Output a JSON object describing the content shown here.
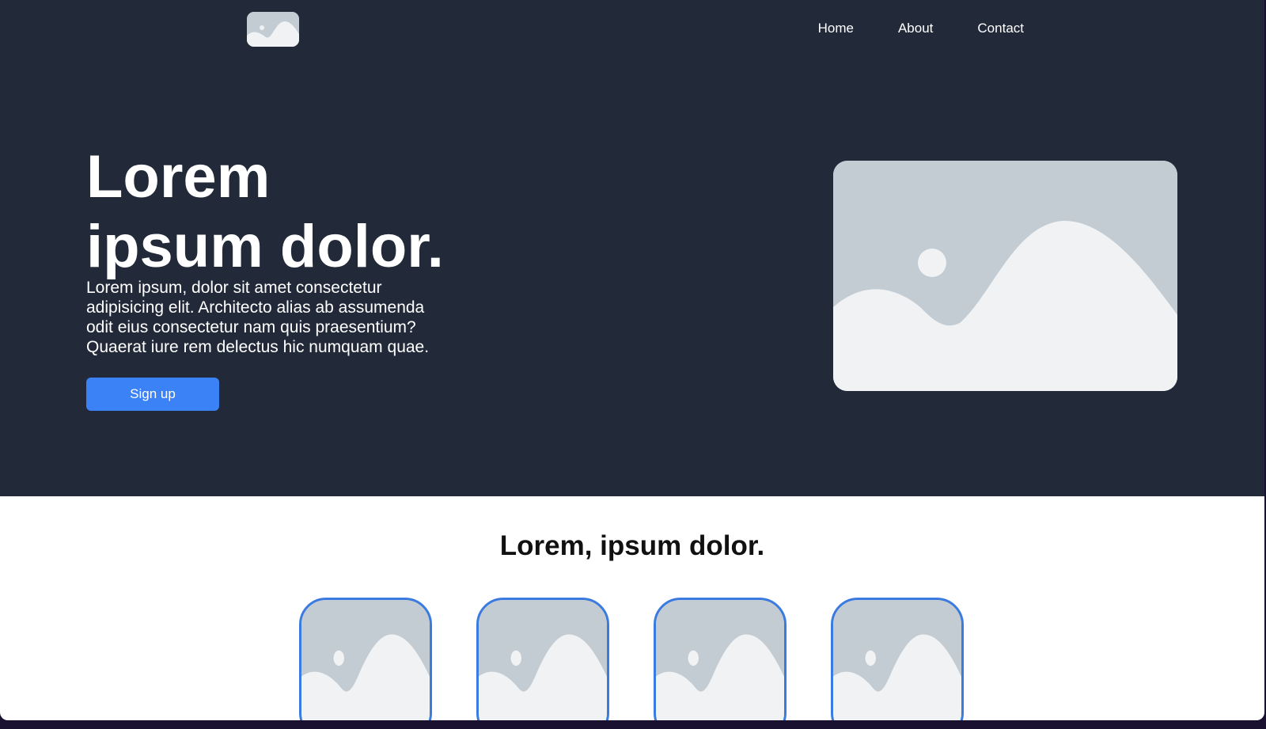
{
  "nav": {
    "logo_icon": "image-placeholder-icon",
    "links": [
      {
        "label": "Home"
      },
      {
        "label": "About"
      },
      {
        "label": "Contact"
      }
    ]
  },
  "hero": {
    "title_line1": "Lorem",
    "title_line2": "ipsum dolor.",
    "description": "Lorem ipsum, dolor sit amet consectetur adipisicing elit. Architecto alias ab assumenda odit eius consectetur nam quis praesentium? Quaerat iure rem delectus hic numquam quae.",
    "cta_label": "Sign up",
    "image_icon": "image-placeholder-icon"
  },
  "features": {
    "title": "Lorem, ipsum dolor.",
    "cards": [
      {
        "icon": "image-placeholder-icon"
      },
      {
        "icon": "image-placeholder-icon"
      },
      {
        "icon": "image-placeholder-icon"
      },
      {
        "icon": "image-placeholder-icon"
      }
    ]
  },
  "colors": {
    "hero_background": "#222a3a",
    "accent": "#3b82f6",
    "card_border": "#3b7be0",
    "placeholder_back": "#c3cbd3",
    "placeholder_front": "#f0f2f4"
  }
}
